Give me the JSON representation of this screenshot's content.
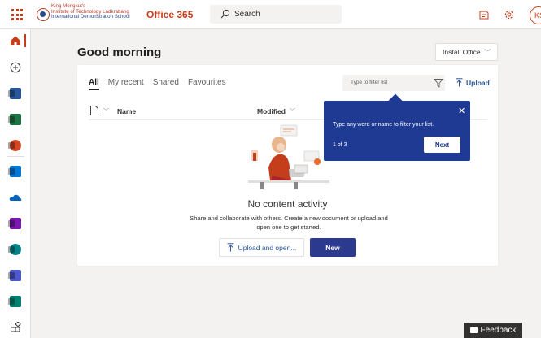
{
  "header": {
    "school_lines": [
      "King Mongkut's",
      "Institute of Technology Ladkrabang",
      "International Demonstration School"
    ],
    "app_name": "Office 365",
    "search_placeholder": "Search",
    "avatar_initials": "KS",
    "icons": [
      "app-launcher-icon",
      "school-seal-icon",
      "search-icon",
      "notes-icon",
      "settings-icon"
    ]
  },
  "rail": {
    "items": [
      {
        "name": "home",
        "icon": "home-icon",
        "active": true
      },
      {
        "name": "create",
        "icon": "plus-circle-icon"
      },
      {
        "name": "word",
        "icon": "word-icon",
        "color": "#2b579a"
      },
      {
        "name": "excel",
        "icon": "excel-icon",
        "color": "#217346"
      },
      {
        "name": "powerpoint",
        "icon": "powerpoint-icon",
        "color": "#d24726"
      },
      {
        "name": "outlook",
        "icon": "outlook-icon",
        "color": "#0078d4"
      },
      {
        "name": "onedrive",
        "icon": "onedrive-icon",
        "color": "#0364b8"
      },
      {
        "name": "onenote",
        "icon": "onenote-icon",
        "color": "#7719aa"
      },
      {
        "name": "sharepoint",
        "icon": "sharepoint-icon",
        "color": "#038387"
      },
      {
        "name": "teams",
        "icon": "teams-icon",
        "color": "#5059c9"
      },
      {
        "name": "sway",
        "icon": "sway-icon",
        "color": "#008272"
      },
      {
        "name": "all-apps",
        "icon": "all-apps-icon"
      }
    ]
  },
  "main": {
    "greeting": "Good morning",
    "install_label": "Install Office",
    "tabs": [
      {
        "label": "All",
        "active": true
      },
      {
        "label": "My recent"
      },
      {
        "label": "Shared"
      },
      {
        "label": "Favourites"
      }
    ],
    "filter_placeholder": "Type to filter list",
    "upload_label": "Upload",
    "columns": {
      "name": "Name",
      "modified": "Modified"
    },
    "empty_title": "No content activity",
    "empty_desc": "Share and collaborate with others. Create a new document or upload and open one to get started.",
    "upload_open_label": "Upload and open...",
    "new_label": "New"
  },
  "coachmark": {
    "message": "Type any word or name to filter your list.",
    "count": "1 of 3",
    "next_label": "Next",
    "close_glyph": "✕"
  },
  "feedback_label": "Feedback",
  "colors": {
    "accent": "#c43e1c",
    "primary": "#2b3a8f",
    "coach_bg": "#1f3a93"
  }
}
